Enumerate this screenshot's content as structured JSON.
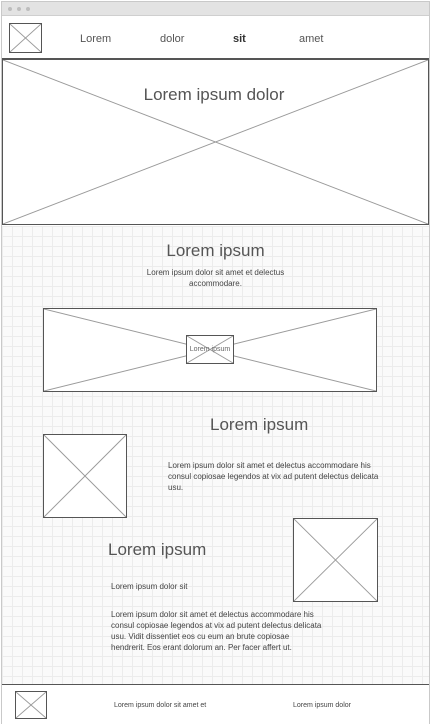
{
  "nav": {
    "items": [
      {
        "label": "Lorem",
        "active": false
      },
      {
        "label": "dolor",
        "active": false
      },
      {
        "label": "sit",
        "active": true
      },
      {
        "label": "amet",
        "active": false
      }
    ]
  },
  "hero": {
    "title": "Lorem ipsum dolor"
  },
  "intro": {
    "title": "Lorem ipsum",
    "text": "Lorem ipsum dolor sit amet et delectus accommodare."
  },
  "banner": {
    "caption": "Lorem ipsum"
  },
  "feature1": {
    "title": "Lorem ipsum",
    "text": "Lorem ipsum dolor sit amet et delectus accommodare his consul copiosae legendos at vix ad putent delectus delicata usu."
  },
  "feature2": {
    "title": "Lorem ipsum",
    "subtitle": "Lorem ipsum dolor sit",
    "text": "Lorem ipsum dolor sit amet et delectus accommodare his consul copiosae legendos at vix ad putent delectus delicata usu. Vidit dissentiet eos cu eum an brute copiosae hendrerit. Eos erant dolorum an. Per facer affert ut."
  },
  "footer": {
    "text1": "Lorem ipsum dolor sit amet et",
    "text2": "Lorem ipsum dolor"
  },
  "icons": {
    "logo": "image-placeholder-icon"
  },
  "colors": {
    "border": "#555555",
    "placeholder_line": "#9a9a9a",
    "grid": "#ececec"
  }
}
